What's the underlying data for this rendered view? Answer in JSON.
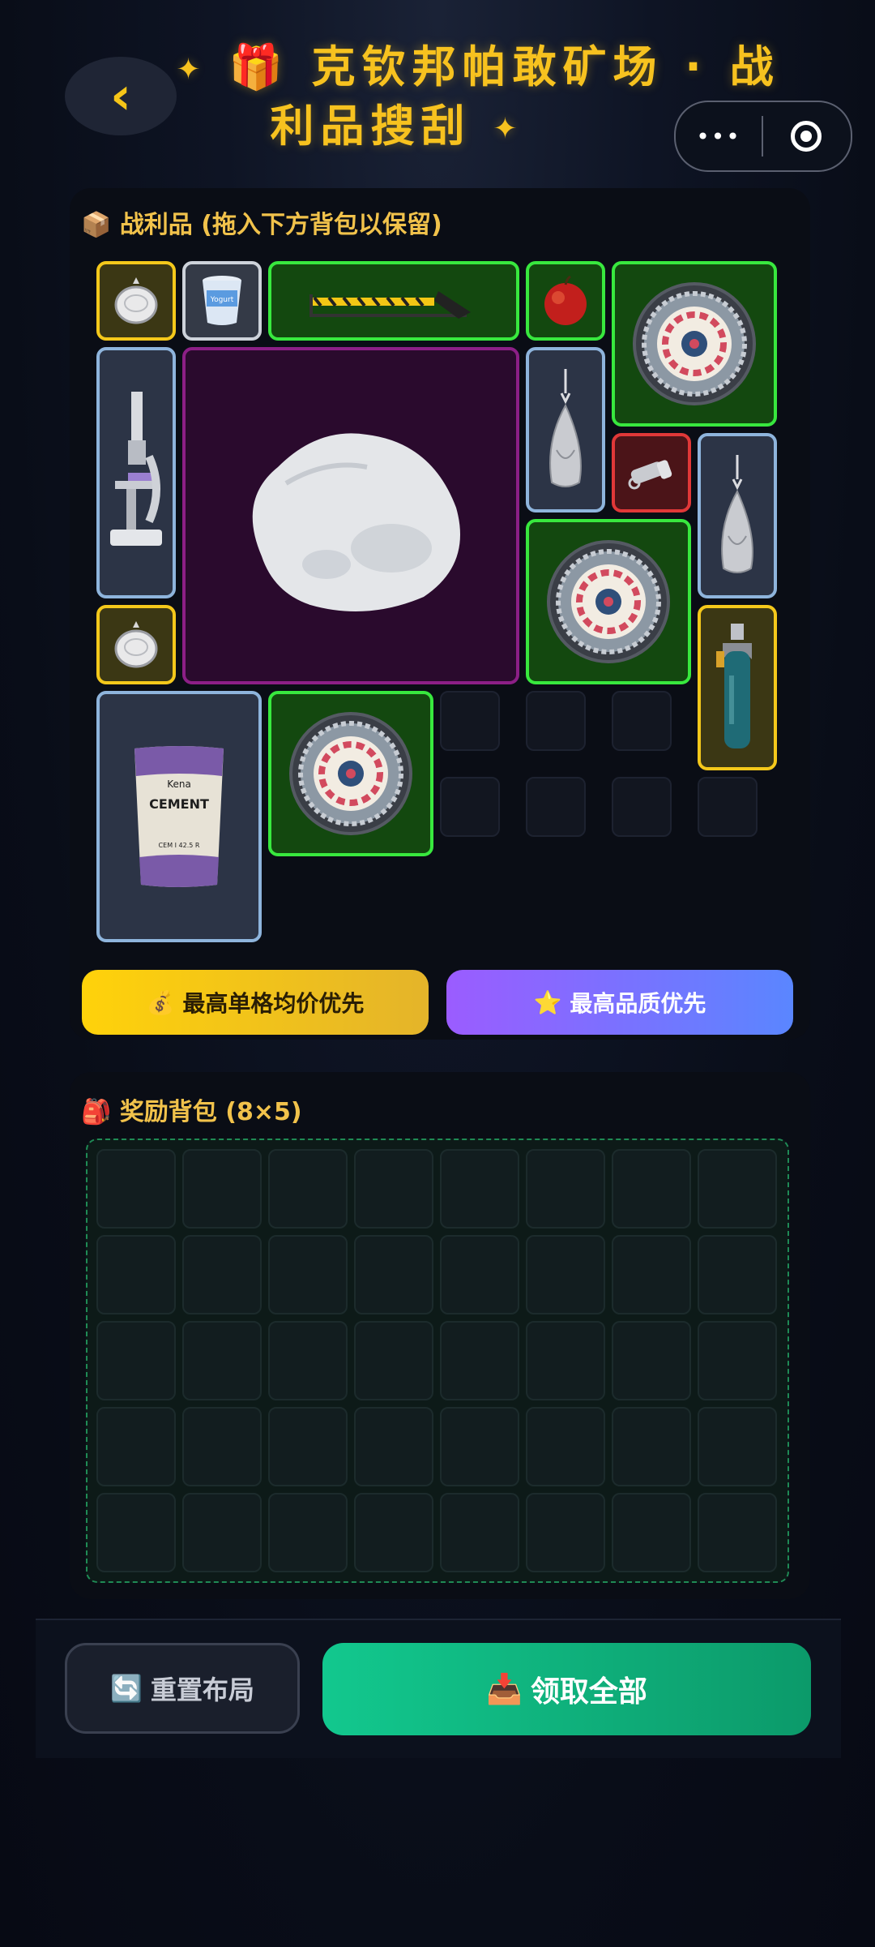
{
  "header": {
    "back_icon": "‹",
    "title_line1": "克钦邦帕敢矿场 · 战",
    "title_line2": "利品搜刮",
    "title_icon": "🎁",
    "spark": "✦",
    "more_icon": "•••"
  },
  "loot": {
    "icon": "📦",
    "title": "战利品 (拖入下方背包以保留)",
    "items": [
      {
        "name": "silver-pocket-watch",
        "quality": "yellow"
      },
      {
        "name": "yogurt-cup",
        "quality": "white",
        "label": "Yogurt"
      },
      {
        "name": "hacksaw",
        "quality": "green"
      },
      {
        "name": "apple",
        "quality": "green"
      },
      {
        "name": "decorated-plate",
        "quality": "green"
      },
      {
        "name": "microscope",
        "quality": "blue"
      },
      {
        "name": "white-stone",
        "quality": "purple"
      },
      {
        "name": "silver-pendant",
        "quality": "blue"
      },
      {
        "name": "flashlight",
        "quality": "red"
      },
      {
        "name": "silver-pendant",
        "quality": "blue"
      },
      {
        "name": "decorated-plate",
        "quality": "green"
      },
      {
        "name": "silver-pocket-watch",
        "quality": "yellow"
      },
      {
        "name": "gas-cylinder",
        "quality": "yellow"
      },
      {
        "name": "cement-bag",
        "quality": "blue",
        "brand": "Kena",
        "label": "CEMENT",
        "spec": "CEM I 42.5 R"
      },
      {
        "name": "decorated-plate",
        "quality": "green"
      }
    ],
    "sort_price_icon": "💰",
    "sort_price_label": "最高单格均价优先",
    "sort_quality_icon": "⭐",
    "sort_quality_label": "最高品质优先"
  },
  "bag": {
    "icon": "🎒",
    "title": "奖励背包 (8×5)"
  },
  "actions": {
    "reset_icon": "🔄",
    "reset_label": "重置布局",
    "claim_icon": "📥",
    "claim_label": "领取全部"
  },
  "colors": {
    "accent_gold": "#f7c21f",
    "claim_green": "#12c88e",
    "quality_yellow": "#f4c81b",
    "quality_green": "#38e83e",
    "quality_blue": "#8eb4dc",
    "quality_red": "#e03838",
    "quality_purple": "#8c1f86"
  }
}
